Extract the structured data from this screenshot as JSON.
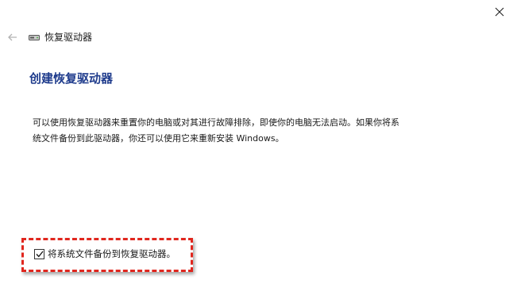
{
  "window": {
    "title": "恢复驱动器",
    "close_icon": "close-icon",
    "back_icon": "back-arrow-icon",
    "drive_icon": "drive-icon"
  },
  "page": {
    "heading": "创建恢复驱动器",
    "description_line1": "可以使用恢复驱动器来重置你的电脑或对其进行故障排除，即使你的电脑无法启动。如果你将系",
    "description_line2": "统文件备份到此驱动器，你还可以使用它来重新安装 Windows。"
  },
  "options": {
    "backup_checkbox": {
      "label": "将系统文件备份到恢复驱动器。",
      "checked": true
    }
  },
  "colors": {
    "heading": "#1e3b8c",
    "highlight": "#e0261e"
  }
}
